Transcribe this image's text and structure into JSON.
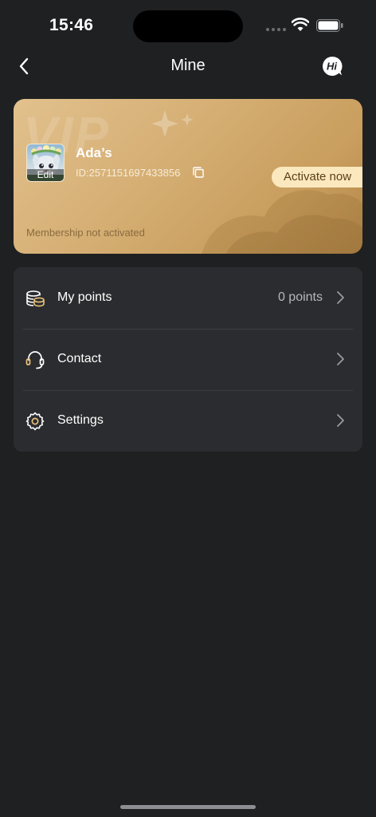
{
  "status_bar": {
    "time": "15:46"
  },
  "nav": {
    "title": "Mine",
    "back_icon": "chevron-left-icon",
    "service_icon": "hi-chat-icon"
  },
  "vip_card": {
    "watermark": "VIP",
    "user_name": "Ada’s",
    "user_id": "ID:2571151697433856",
    "avatar_edit_label": "Edit",
    "activate_label": "Activate now",
    "membership_status": "Membership not activated",
    "colors": {
      "gold": "#d4ad72",
      "button_bg": "#fbe8be",
      "button_text": "#5b3f15"
    }
  },
  "menu": {
    "items": [
      {
        "icon": "points-coins-icon",
        "label": "My points",
        "value": "0 points"
      },
      {
        "icon": "headset-icon",
        "label": "Contact",
        "value": ""
      },
      {
        "icon": "settings-gear-icon",
        "label": "Settings",
        "value": ""
      }
    ]
  }
}
